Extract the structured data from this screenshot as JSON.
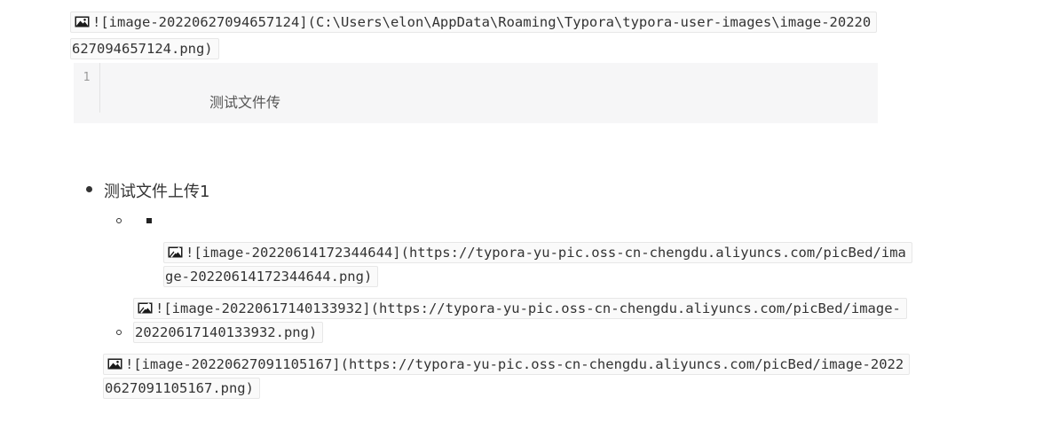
{
  "image_links": {
    "first": {
      "line1": "![image-20220627094657124](C:\\Users\\elon\\AppData\\Roaming\\Typora\\typora-user-images\\image-20220",
      "line2": "627094657124.png)",
      "icon": "image-icon"
    },
    "second": {
      "line1": "![image-20220614172344644](https://typora-yu-pic.oss-cn-chengdu.aliyuncs.com/picBed/ima",
      "line2": "ge-20220614172344644.png)",
      "icon": "broken-image-icon"
    },
    "third": {
      "line1": "![image-20220617140133932](https://typora-yu-pic.oss-cn-chengdu.aliyuncs.com/picBed/image-",
      "line2": "20220617140133932.png)",
      "icon": "broken-image-icon"
    },
    "fourth": {
      "line1": "![image-20220627091105167](https://typora-yu-pic.oss-cn-chengdu.aliyuncs.com/picBed/image-2022",
      "line2": "0627091105167.png)",
      "icon": "image-icon"
    }
  },
  "code_block": {
    "line_number": "1",
    "text": "测试文件传"
  },
  "list": {
    "item1": "测试文件上传1"
  }
}
